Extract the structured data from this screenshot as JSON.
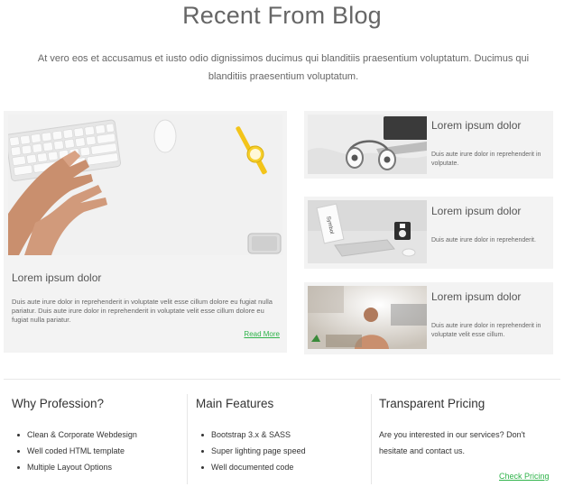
{
  "section": {
    "title": "Recent From Blog",
    "intro": "At vero eos et accusamus et iusto odio dignissimos ducimus qui blanditiis praesentium voluptatum. Ducimus qui blanditiis praesentium voluptatum."
  },
  "featured": {
    "title": "Lorem ipsum dolor",
    "excerpt": "Duis aute irure dolor in reprehenderit in voluptate velit esse cillum dolore eu fugiat nulla pariatur. Duis aute irure dolor in reprehenderit in voluptate velit esse cillum dolore eu fugiat nulla pariatur.",
    "read_more": "Read More"
  },
  "posts": [
    {
      "title": "Lorem ipsum dolor",
      "excerpt": "Duis aute irure dolor in reprehenderit in volputate."
    },
    {
      "title": "Lorem ipsum dolor",
      "excerpt": "Duis aute irure dolor in reprehenderit."
    },
    {
      "title": "Lorem ipsum dolor",
      "excerpt": "Duis aute irure dolor in reprehenderit in voluptate velit esse cillum."
    }
  ],
  "footer": {
    "profession": {
      "title": "Why Profession?",
      "items": [
        "Clean & Corporate Webdesign",
        "Well coded HTML template",
        "Multiple Layout Options"
      ]
    },
    "features": {
      "title": "Main Features",
      "items": [
        "Bootstrap 3.x & SASS",
        "Super lighting page speed",
        "Well documented code"
      ]
    },
    "pricing": {
      "title": "Transparent Pricing",
      "text": "Are you interested in our services? Don't hesitate and contact us.",
      "link": "Check Pricing"
    }
  },
  "colors": {
    "accent": "#2fb34a",
    "card_bg": "#f3f3f3",
    "heading": "#666666"
  }
}
